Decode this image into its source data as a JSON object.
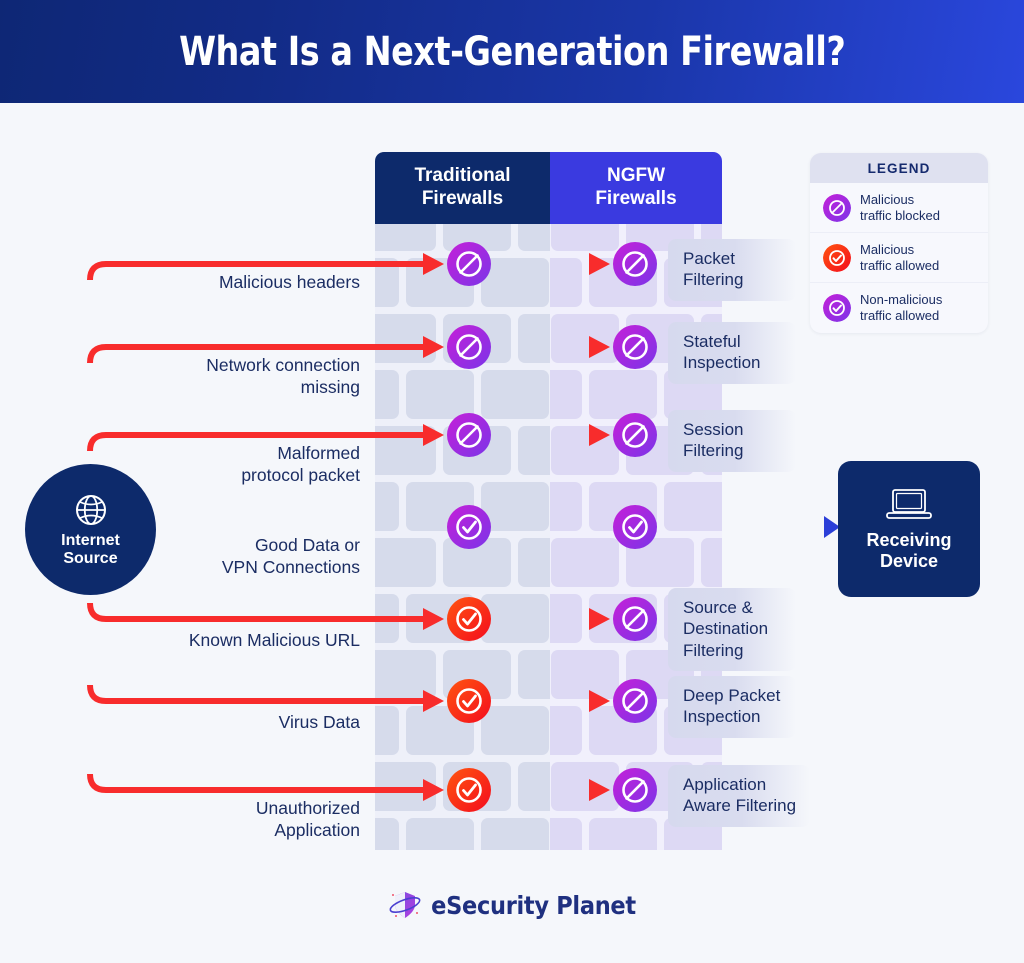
{
  "header": {
    "title": "What Is a Next-Generation Firewall?"
  },
  "columns": [
    {
      "id": "traditional",
      "label": "Traditional\nFirewalls",
      "line1": "Traditional",
      "line2": "Firewalls",
      "color": "#0d2a6b"
    },
    {
      "id": "ngfw",
      "label": "NGFW\nFirewalls",
      "line1": "NGFW",
      "line2": "Firewalls",
      "color": "#3a3ae0"
    }
  ],
  "source": {
    "label_line1": "Internet",
    "label_line2": "Source",
    "icon": "globe-icon"
  },
  "device": {
    "label_line1": "Receiving",
    "label_line2": "Device",
    "icon": "laptop-icon"
  },
  "legend": {
    "title": "LEGEND",
    "items": [
      {
        "icon": "blocked-icon",
        "color": "#9b30d9",
        "line1": "Malicious",
        "line2": "traffic blocked"
      },
      {
        "icon": "allowed-red-icon",
        "color": "#f93309",
        "line1": "Malicious",
        "line2": "traffic allowed"
      },
      {
        "icon": "allowed-purple-icon",
        "color": "#9b30d9",
        "line1": "Non-malicious",
        "line2": "traffic allowed"
      }
    ]
  },
  "rows": [
    {
      "threat_line1": "Malicious headers",
      "threat_line2": "",
      "feature_line1": "Packet",
      "feature_line2": "Filtering",
      "feature_line3": "",
      "traditional": "blocked",
      "ngfw": "blocked",
      "line_color": "#f82c2c"
    },
    {
      "threat_line1": "Network connection",
      "threat_line2": "missing",
      "feature_line1": "Stateful",
      "feature_line2": "Inspection",
      "feature_line3": "",
      "traditional": "blocked",
      "ngfw": "blocked",
      "line_color": "#f82c2c"
    },
    {
      "threat_line1": "Malformed",
      "threat_line2": "protocol packet",
      "feature_line1": "Session",
      "feature_line2": "Filtering",
      "feature_line3": "",
      "traditional": "blocked",
      "ngfw": "blocked",
      "line_color": "#f82c2c"
    },
    {
      "threat_line1": "Good Data or",
      "threat_line2": "VPN Connections",
      "feature_line1": "",
      "feature_line2": "",
      "feature_line3": "",
      "traditional": "allowed-purple",
      "ngfw": "allowed-purple",
      "line_color": "#bb18e0"
    },
    {
      "threat_line1": "Known Malicious URL",
      "threat_line2": "",
      "feature_line1": "Source &",
      "feature_line2": "Destination",
      "feature_line3": "Filtering",
      "traditional": "allowed-red",
      "ngfw": "blocked",
      "line_color": "#f82c2c"
    },
    {
      "threat_line1": "Virus Data",
      "threat_line2": "",
      "feature_line1": "Deep Packet",
      "feature_line2": "Inspection",
      "feature_line3": "",
      "traditional": "allowed-red",
      "ngfw": "blocked",
      "line_color": "#f82c2c"
    },
    {
      "threat_line1": "Unauthorized",
      "threat_line2": "Application",
      "feature_line1": "Application",
      "feature_line2": "Aware Filtering",
      "feature_line3": "",
      "traditional": "allowed-red",
      "ngfw": "blocked",
      "line_color": "#f82c2c"
    }
  ],
  "footer": {
    "brand": "eSecurity Planet",
    "icon": "shield-planet-icon"
  },
  "colors": {
    "background": "#f5f7fb",
    "navy": "#0d2a6b",
    "indigo": "#3a3ae0",
    "red": "#f82c2c",
    "purple": "#9b30d9",
    "orange_red": "#f93309",
    "wall_left": "#d6dbeb",
    "wall_right": "#ddd9f4"
  }
}
